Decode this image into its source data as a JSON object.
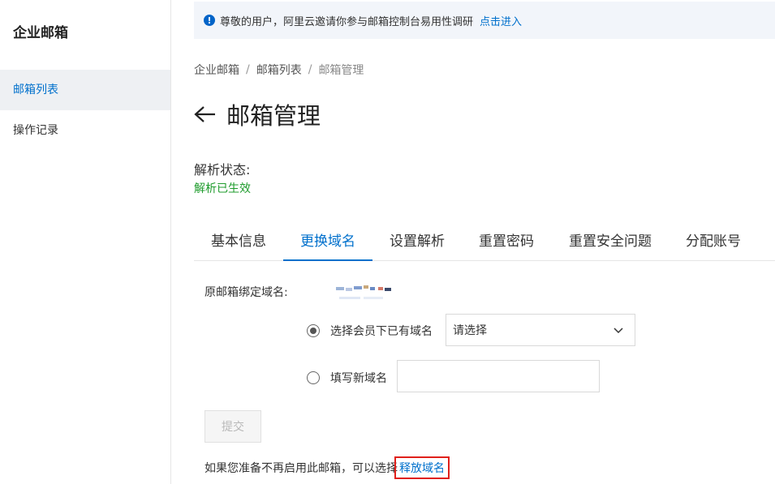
{
  "sidebar": {
    "title": "企业邮箱",
    "items": [
      {
        "label": "邮箱列表",
        "active": true
      },
      {
        "label": "操作记录",
        "active": false
      }
    ]
  },
  "notice": {
    "icon": "info-icon",
    "text": "尊敬的用户，阿里云邀请你参与邮箱控制台易用性调研",
    "link": "点击进入"
  },
  "breadcrumb": [
    "企业邮箱",
    "邮箱列表",
    "邮箱管理"
  ],
  "page": {
    "title": "邮箱管理"
  },
  "status": {
    "label": "解析状态:",
    "value": "解析已生效",
    "value_color": "#1f9c2d"
  },
  "tabs": [
    {
      "label": "基本信息",
      "active": false
    },
    {
      "label": "更换域名",
      "active": true
    },
    {
      "label": "设置解析",
      "active": false
    },
    {
      "label": "重置密码",
      "active": false
    },
    {
      "label": "重置安全问题",
      "active": false
    },
    {
      "label": "分配账号",
      "active": false
    }
  ],
  "form": {
    "original_domain_label": "原邮箱绑定域名:",
    "option_existing_label": "选择会员下已有域名",
    "option_existing_selected": true,
    "select_value": "请选择",
    "option_new_label": "填写新域名",
    "option_new_selected": false,
    "new_domain_value": "",
    "submit_label": "提交"
  },
  "footer": {
    "text": "如果您准备不再启用此邮箱，可以选择",
    "link": "释放域名"
  },
  "colors": {
    "accent": "#0070cc",
    "success": "#1f9c2d",
    "highlight": "#e0201b"
  }
}
